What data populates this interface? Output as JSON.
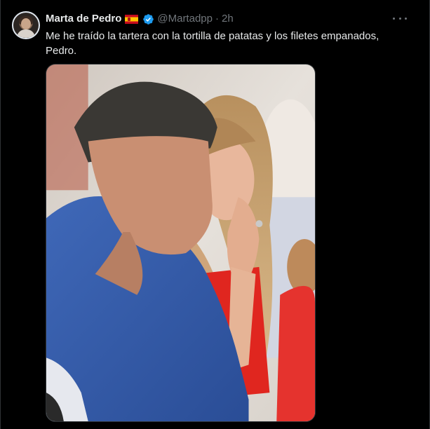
{
  "tweet": {
    "author_name": "Marta de Pedro",
    "author_flag": "spain-flag-icon",
    "verified_icon": "verified-badge-icon",
    "handle": "@Martadpp",
    "separator": "·",
    "time": "2h",
    "more_icon": "more-horizontal-icon",
    "text_line1": "Me he traído la tartera con la tortilla de patatas y los filetes empanados,",
    "text_line2": "Pedro.",
    "media_alt": "photo"
  },
  "colors": {
    "background": "#000000",
    "text_primary": "#e7e9ea",
    "text_secondary": "#71767b",
    "verified_blue": "#1d9bf0",
    "border": "#2f3336"
  }
}
